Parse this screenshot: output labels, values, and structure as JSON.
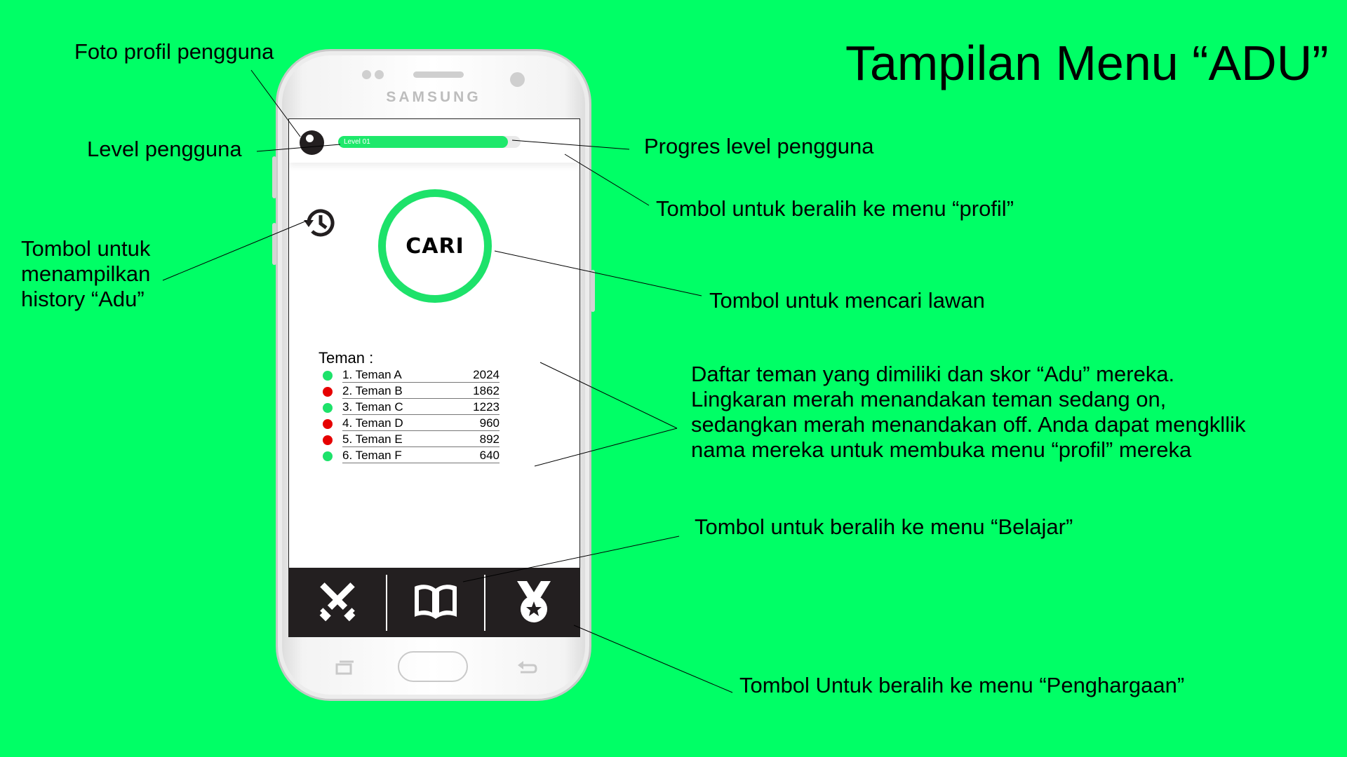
{
  "title": "Tampilan Menu “ADU”",
  "annotations": {
    "foto_profil": "Foto profil pengguna",
    "level": "Level pengguna",
    "history": "Tombol untuk menampilkan history “Adu”",
    "progres": "Progres level pengguna",
    "profil_btn": "Tombol untuk beralih ke menu “profil”",
    "cari_btn": "Tombol untuk mencari lawan",
    "friends": "Daftar teman yang dimiliki dan skor “Adu” mereka. Lingkaran merah menandakan teman sedang on, sedangkan merah menandakan off. Anda dapat mengkllik nama mereka untuk membuka menu “profil” mereka",
    "belajar": "Tombol untuk beralih ke menu “Belajar”",
    "penghargaan": "Tombol Untuk beralih ke menu “Penghargaan”"
  },
  "phone": {
    "brand": "SAMSUNG",
    "screen": {
      "level_label": "Level 01",
      "progress": 0.93,
      "cari_label": "CARI",
      "friends_title": "Teman :",
      "friends": [
        {
          "name": "1. Teman A",
          "score": "2024",
          "status_color": "#1de26a"
        },
        {
          "name": "2. Teman B",
          "score": "1862",
          "status_color": "#e60000"
        },
        {
          "name": "3. Teman C",
          "score": "1223",
          "status_color": "#1de26a"
        },
        {
          "name": "4. Teman D",
          "score": "960",
          "status_color": "#e60000"
        },
        {
          "name": "5. Teman E",
          "score": "892",
          "status_color": "#e60000"
        },
        {
          "name": "6. Teman F",
          "score": "640",
          "status_color": "#1de26a"
        }
      ],
      "nav": [
        "swords-icon",
        "book-icon",
        "medal-icon"
      ]
    }
  },
  "colors": {
    "background": "#00ff66",
    "accent": "#1de26a",
    "navbar": "#231f20"
  }
}
